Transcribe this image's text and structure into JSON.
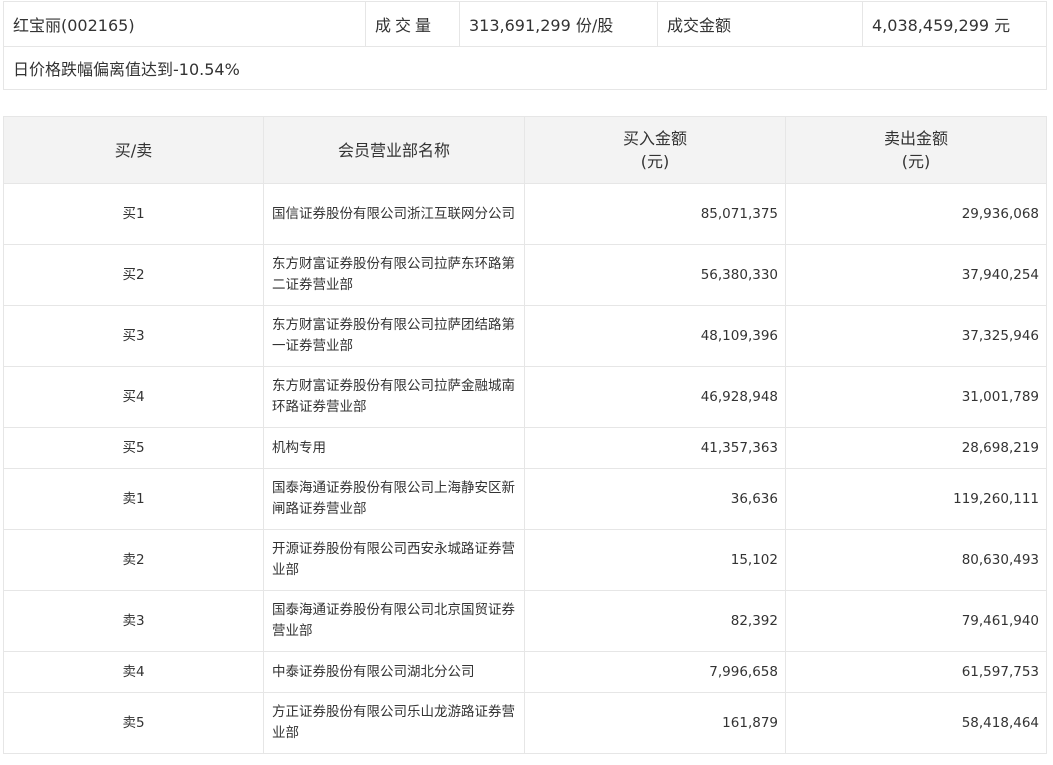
{
  "summary": {
    "stock": "红宝丽(002165)",
    "volume_label": "成交量",
    "volume_value": "313,691,299 份/股",
    "amount_label": "成交金额",
    "amount_value": "4,038,459,299 元",
    "reason": "日价格跌幅偏离值达到-10.54%"
  },
  "table": {
    "headers": {
      "direction": "买/卖",
      "member": "会员营业部名称",
      "buy_line1": "买入金额",
      "buy_line2": "(元)",
      "sell_line1": "卖出金额",
      "sell_line2": "(元)"
    },
    "rows": [
      {
        "direction": "买1",
        "member": "国信证券股份有限公司浙江互联网分公司",
        "buy": "85,071,375",
        "sell": "29,936,068"
      },
      {
        "direction": "买2",
        "member": "东方财富证券股份有限公司拉萨东环路第二证券营业部",
        "buy": "56,380,330",
        "sell": "37,940,254"
      },
      {
        "direction": "买3",
        "member": "东方财富证券股份有限公司拉萨团结路第一证券营业部",
        "buy": "48,109,396",
        "sell": "37,325,946"
      },
      {
        "direction": "买4",
        "member": "东方财富证券股份有限公司拉萨金融城南环路证券营业部",
        "buy": "46,928,948",
        "sell": "31,001,789"
      },
      {
        "direction": "买5",
        "member": "机构专用",
        "buy": "41,357,363",
        "sell": "28,698,219"
      },
      {
        "direction": "卖1",
        "member": "国泰海通证券股份有限公司上海静安区新闸路证券营业部",
        "buy": "36,636",
        "sell": "119,260,111"
      },
      {
        "direction": "卖2",
        "member": "开源证券股份有限公司西安永城路证券营业部",
        "buy": "15,102",
        "sell": "80,630,493"
      },
      {
        "direction": "卖3",
        "member": "国泰海通证券股份有限公司北京国贸证券营业部",
        "buy": "82,392",
        "sell": "79,461,940"
      },
      {
        "direction": "卖4",
        "member": "中泰证券股份有限公司湖北分公司",
        "buy": "7,996,658",
        "sell": "61,597,753"
      },
      {
        "direction": "卖5",
        "member": "方正证券股份有限公司乐山龙游路证券营业部",
        "buy": "161,879",
        "sell": "58,418,464"
      }
    ]
  }
}
